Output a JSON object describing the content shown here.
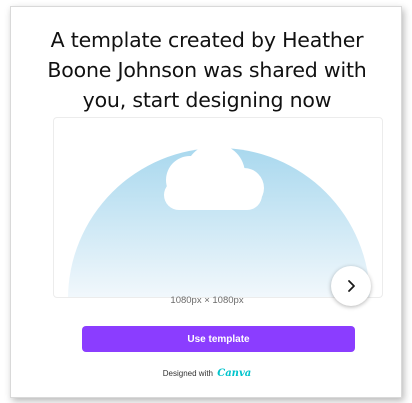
{
  "header": {
    "title_line1": "A template created by Heather",
    "title_line2": "Boone Johnson was shared with",
    "title_line3": "you, start designing now"
  },
  "preview": {
    "dimensions": "1080px × 1080px",
    "next_icon": "chevron-right-icon",
    "sky_top_color": "#a9d8ee",
    "sky_bottom_color": "#f2f8fc"
  },
  "actions": {
    "use_template_label": "Use template"
  },
  "footer": {
    "designed_with": "Designed with",
    "brand": "Canva"
  },
  "colors": {
    "accent": "#8b3dff",
    "brand": "#00c4cc"
  }
}
